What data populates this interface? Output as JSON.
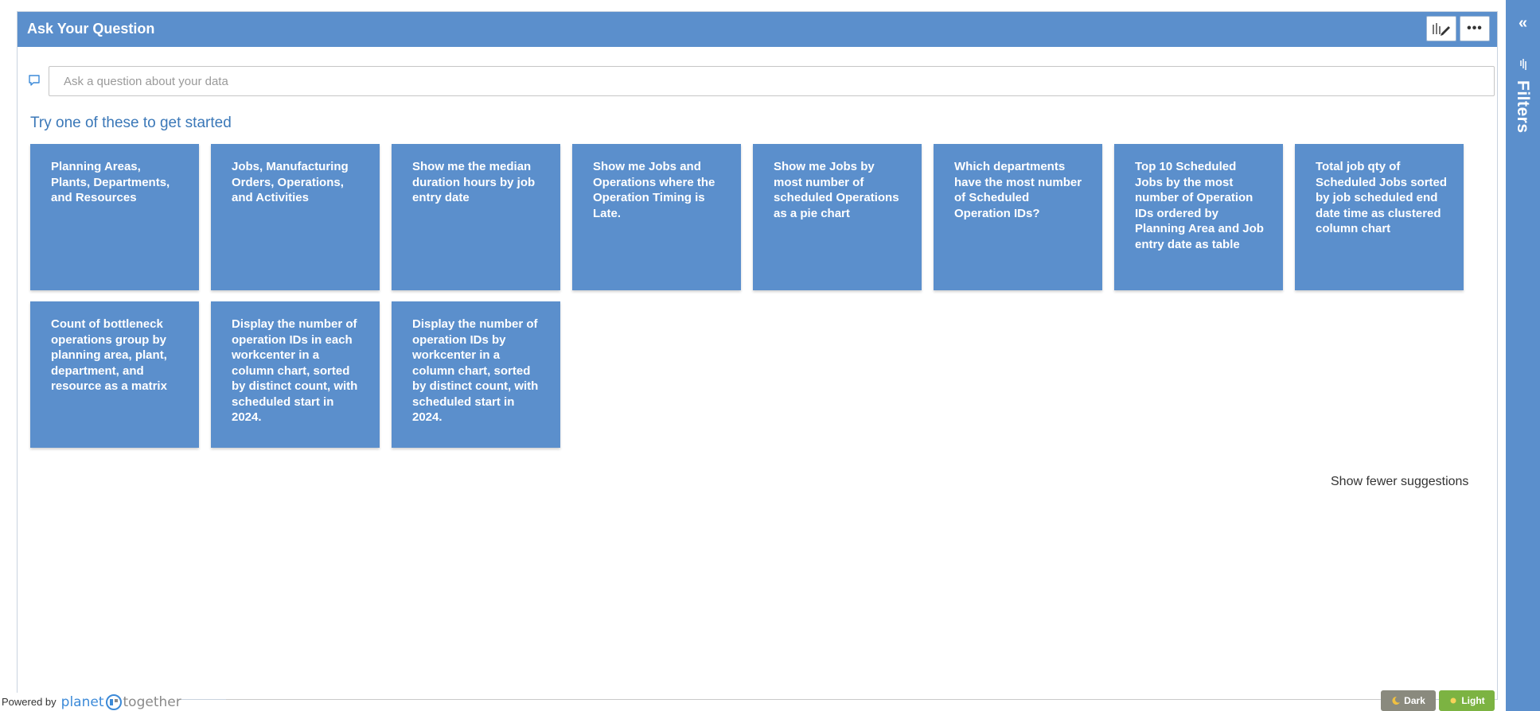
{
  "header": {
    "title": "Ask Your Question"
  },
  "question": {
    "placeholder": "Ask a question about your data",
    "value": ""
  },
  "suggestions_heading": "Try one of these to get started",
  "suggestions": [
    "Planning Areas, Plants, Departments, and Resources",
    "Jobs, Manufacturing Orders, Operations, and Activities",
    "Show me the median duration hours by job entry date",
    "Show me Jobs and Operations where the Operation Timing is Late.",
    "Show me Jobs by most number of scheduled Operations as a pie chart",
    "Which departments have the most number of Scheduled Operation IDs?",
    "Top 10 Scheduled Jobs by the most number of Operation IDs ordered by Planning Area and Job entry date as table",
    "Total job qty of Scheduled Jobs sorted by job scheduled end date time as clustered column chart",
    "Count of bottleneck operations group by planning area, plant, department, and resource as a matrix",
    "Display the number of operation IDs in each workcenter in a column chart, sorted by distinct count, with scheduled start in 2024.",
    "Display the number of operation IDs by workcenter in a column chart, sorted by distinct count, with scheduled start in 2024."
  ],
  "show_fewer_label": "Show fewer suggestions",
  "footer": {
    "powered_by": "Powered by",
    "brand_part1": "planet",
    "brand_part2": "together"
  },
  "theme": {
    "dark_label": "Dark",
    "light_label": "Light"
  },
  "filters_pane": {
    "label": "Filters",
    "collapse_glyph": "«"
  },
  "colors": {
    "accent": "#5b8fcc",
    "heading": "#3b78b8",
    "light_button": "#7cb342",
    "dark_button": "#8a8a7e"
  },
  "icons": {
    "edit": "pen-icon",
    "more": "ellipsis-icon",
    "question": "speech-bubble-icon",
    "filter": "funnel-icon"
  }
}
